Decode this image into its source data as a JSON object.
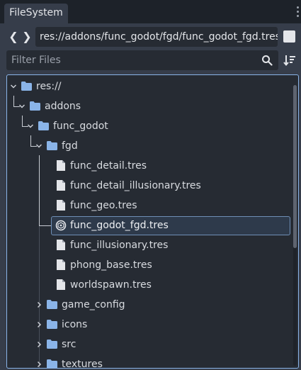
{
  "tab": {
    "title": "FileSystem"
  },
  "navigation": {
    "back_glyph": "❮",
    "forward_glyph": "❯",
    "path": "res://addons/func_godot/fgd/func_godot_fgd.tres"
  },
  "filter": {
    "placeholder": "Filter Files"
  },
  "tree": {
    "root": "res://",
    "addons": "addons",
    "func_godot": "func_godot",
    "fgd": "fgd",
    "files": [
      "func_detail.tres",
      "func_detail_illusionary.tres",
      "func_geo.tres",
      "func_godot_fgd.tres",
      "func_illusionary.tres",
      "phong_base.tres",
      "worldspawn.tres"
    ],
    "collapsed": [
      "game_config",
      "icons",
      "src",
      "textures"
    ],
    "selected": "func_godot_fgd.tres"
  },
  "colors": {
    "accent": "#8ab4e8",
    "folder": "#8ab4e8",
    "selection": "#2e3a4b"
  }
}
